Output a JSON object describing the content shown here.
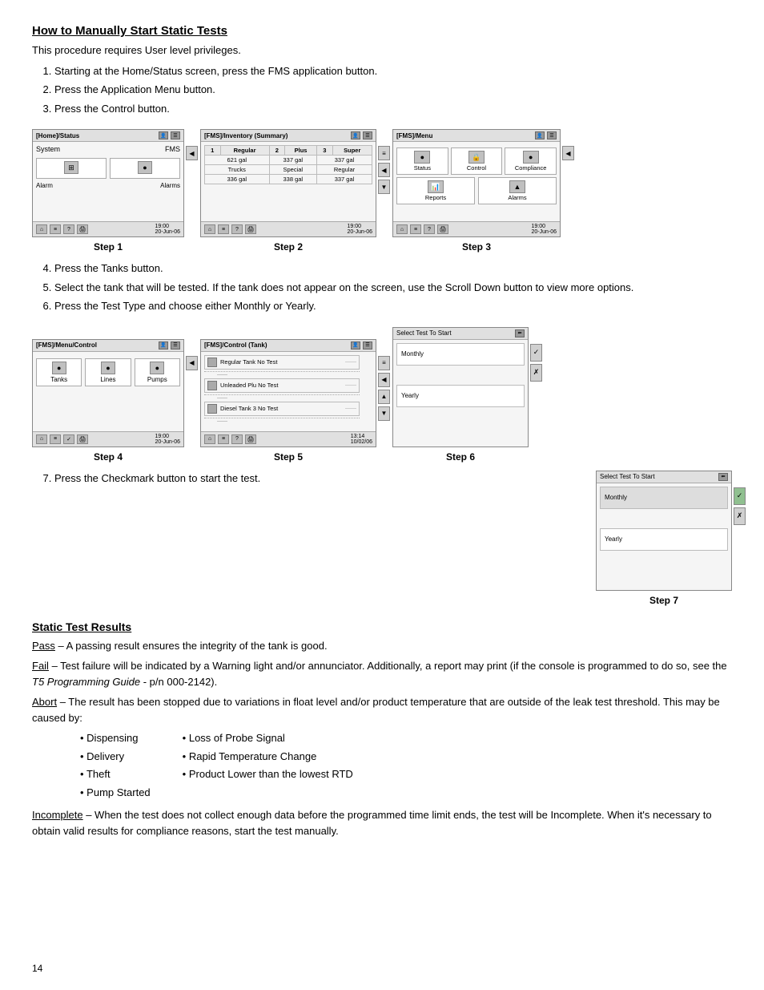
{
  "title": "How to Manually Start Static Tests",
  "intro": "This procedure requires User level privileges.",
  "steps_instructions": [
    "Starting at the Home/Status screen, press the FMS application button.",
    "Press the Application Menu button.",
    "Press the Control button.",
    "Press the Tanks button.",
    "Select the tank that will be tested. If the tank does not appear on the screen, use the Scroll Down button to view more options.",
    "Press the Test Type and choose either Monthly or Yearly.",
    "Press the Checkmark button to start the test."
  ],
  "step_labels": [
    "Step 1",
    "Step 2",
    "Step 3",
    "Step 4",
    "Step 5",
    "Step 6",
    "Step 7"
  ],
  "screen1": {
    "header": "[Home]/Status",
    "label1": "System",
    "label2": "FMS",
    "label3": "Alarm",
    "label4": "Alarms",
    "time": "19:00",
    "date": "20-Jun-06"
  },
  "screen2": {
    "header": "[FMS]/Inventory (Summary)",
    "col1": "Regular",
    "col2": "Plus",
    "col3": "Super",
    "r1c1": "621 gal",
    "r1c2": "337 gal",
    "r1c3": "337 gal",
    "row2_1": "Trucks",
    "row2_2": "Special",
    "row2_3": "Regular",
    "r2c1": "336 gal",
    "r2c2": "338 gal",
    "r2c3": "337 gal",
    "time": "19:00",
    "date": "20-Jun-06"
  },
  "screen3": {
    "header": "[FMS]/Menu",
    "btn1": "Status",
    "btn2": "Control",
    "btn3": "Compliance",
    "btn4": "Reports",
    "btn5": "Alarms",
    "time": "19:00",
    "date": "20-Jun-06"
  },
  "screen4": {
    "header": "[FMS]/Menu/Control",
    "btn1": "Tanks",
    "btn2": "Lines",
    "btn3": "Pumps",
    "time": "19:00",
    "date": "20-Jun-06"
  },
  "screen5": {
    "header": "[FMS]/Control (Tank)",
    "tank1": "Regular Tank  No Test",
    "tank2": "Unleaded Plu  No Test",
    "tank3": "Diesel Tank 3  No Test",
    "time": "13:14",
    "date": "10/02/06"
  },
  "screen6": {
    "header": "Select Test To Start",
    "option1": "Monthly",
    "option2": "Yearly"
  },
  "screen7": {
    "header": "Select Test To Start",
    "option1": "Monthly",
    "option2": "Yearly",
    "note": "checkmark active"
  },
  "results": {
    "title": "Static Test Results",
    "pass_term": "Pass",
    "pass_desc": " – A passing result ensures the integrity of the tank is good.",
    "fail_term": "Fail",
    "fail_desc": " – Test failure will be indicated by a Warning light and/or annunciator. Additionally, a report may print (if the console is programmed to do so, see the ",
    "fail_ref": "T5 Programming Guide",
    "fail_ref_suffix": " - p/n 000-2142).",
    "abort_term": "Abort",
    "abort_desc": " – The result has been stopped due to variations in float level and/or product temperature that are outside of the leak test threshold. This may be caused by:",
    "bullets_left": [
      "Dispensing",
      "Delivery",
      "Theft",
      "Pump Started"
    ],
    "bullets_right": [
      "Loss of Probe Signal",
      "Rapid Temperature Change",
      "Product Lower than the lowest RTD"
    ],
    "incomplete_term": "Incomplete",
    "incomplete_desc": " – When the test does not collect enough data before the programmed time limit ends, the test will be Incomplete. When it's necessary to obtain valid results for compliance reasons, start the test manually."
  },
  "page_number": "14"
}
